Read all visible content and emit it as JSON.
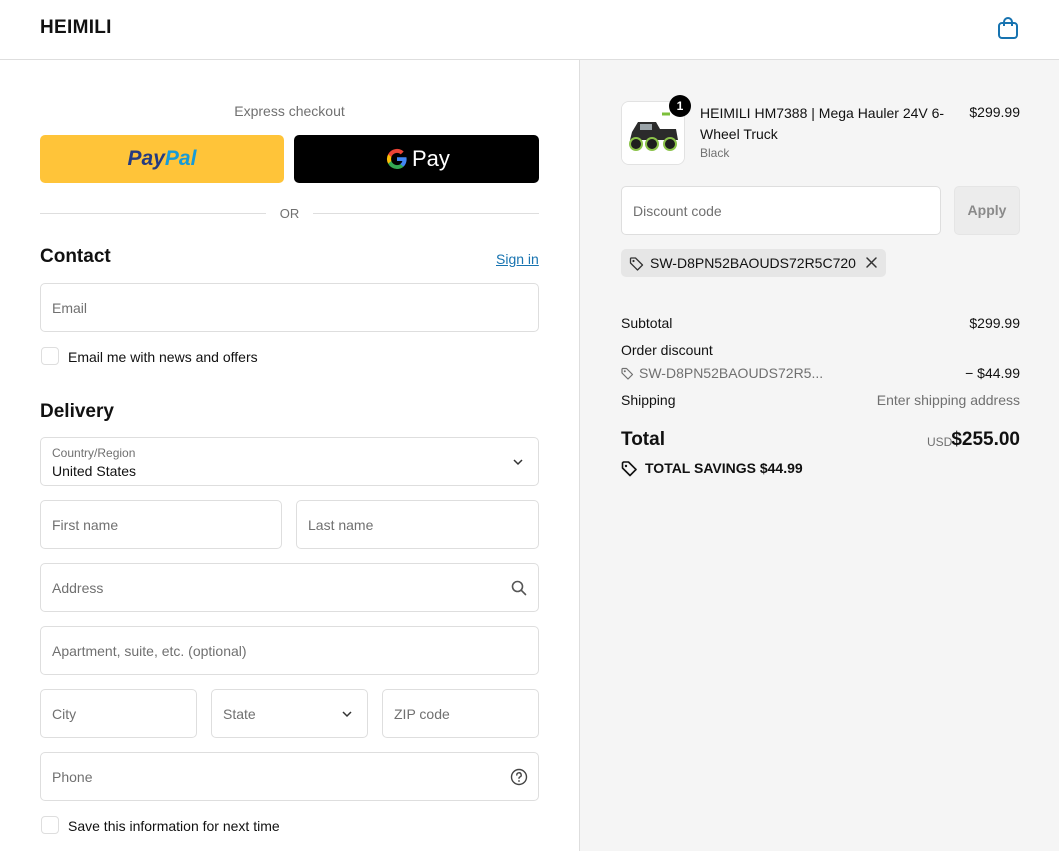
{
  "header": {
    "brand": "HEIMILI",
    "cart_icon": "shopping-bag-icon"
  },
  "express": {
    "title": "Express checkout",
    "paypal_label_1": "Pay",
    "paypal_label_2": "Pal",
    "gpay_label": "Pay",
    "or_label": "OR"
  },
  "contact": {
    "title": "Contact",
    "sign_in": "Sign in",
    "email_placeholder": "Email",
    "newsletter_label": "Email me with news and offers"
  },
  "delivery": {
    "title": "Delivery",
    "country_label": "Country/Region",
    "country_value": "United States",
    "first_name_placeholder": "First name",
    "last_name_placeholder": "Last name",
    "address_placeholder": "Address",
    "apartment_placeholder": "Apartment, suite, etc. (optional)",
    "city_placeholder": "City",
    "state_placeholder": "State",
    "zip_placeholder": "ZIP code",
    "phone_placeholder": "Phone",
    "save_info_label": "Save this information for next time"
  },
  "summary": {
    "product": {
      "quantity": "1",
      "name": "HEIMILI HM7388 | Mega Hauler 24V 6-Wheel Truck",
      "variant": "Black",
      "price": "$299.99"
    },
    "discount_placeholder": "Discount code",
    "apply_label": "Apply",
    "applied_code": "SW-D8PN52BAOUDS72R5C720",
    "subtotal_label": "Subtotal",
    "subtotal_value": "$299.99",
    "order_discount_label": "Order discount",
    "order_discount_code": "SW-D8PN52BAOUDS72R5...",
    "order_discount_value": "− $44.99",
    "shipping_label": "Shipping",
    "shipping_value": "Enter shipping address",
    "total_label": "Total",
    "total_currency": "USD",
    "total_value": "$255.00",
    "savings_label": "TOTAL SAVINGS $44.99"
  },
  "colors": {
    "paypal_yellow": "#ffc439",
    "link_blue": "#1773b0",
    "summary_bg": "#f5f5f5"
  }
}
